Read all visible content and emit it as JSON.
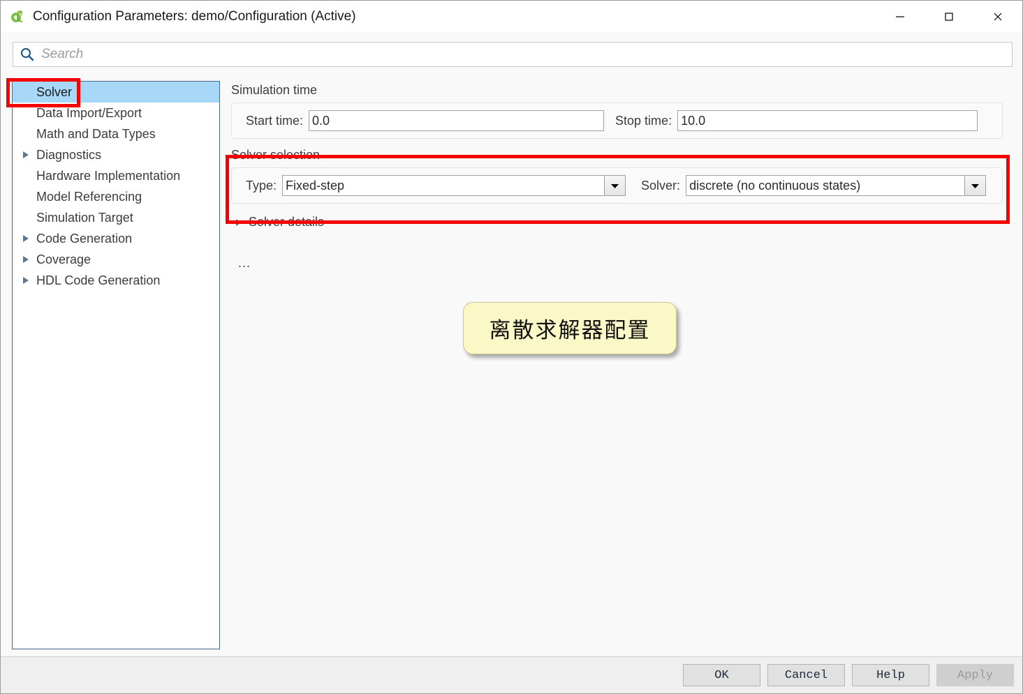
{
  "window": {
    "title": "Configuration Parameters: demo/Configuration (Active)",
    "app_icon": "simulink-gear-icon",
    "controls": {
      "minimize": "—",
      "maximize": "□",
      "close": "✕"
    }
  },
  "search": {
    "placeholder": "Search",
    "value": "",
    "icon": "search-icon"
  },
  "sidebar": {
    "items": [
      {
        "label": "Solver",
        "expandable": false,
        "selected": true
      },
      {
        "label": "Data Import/Export",
        "expandable": false,
        "selected": false
      },
      {
        "label": "Math and Data Types",
        "expandable": false,
        "selected": false
      },
      {
        "label": "Diagnostics",
        "expandable": true,
        "selected": false
      },
      {
        "label": "Hardware Implementation",
        "expandable": false,
        "selected": false
      },
      {
        "label": "Model Referencing",
        "expandable": false,
        "selected": false
      },
      {
        "label": "Simulation Target",
        "expandable": false,
        "selected": false
      },
      {
        "label": "Code Generation",
        "expandable": true,
        "selected": false
      },
      {
        "label": "Coverage",
        "expandable": true,
        "selected": false
      },
      {
        "label": "HDL Code Generation",
        "expandable": true,
        "selected": false
      }
    ]
  },
  "main": {
    "simulation_time": {
      "group_title": "Simulation time",
      "start_time_label": "Start time:",
      "start_time_value": "0.0",
      "stop_time_label": "Stop time:",
      "stop_time_value": "10.0"
    },
    "solver_selection": {
      "group_title": "Solver selection",
      "type_label": "Type:",
      "type_value": "Fixed-step",
      "solver_label": "Solver:",
      "solver_value": "discrete (no continuous states)",
      "dropdown_icon": "chevron-down-icon"
    },
    "solver_details": {
      "label": "Solver details",
      "expander_icon": "triangle-right-icon",
      "expanded": false
    },
    "overflow_text": "..."
  },
  "annotations": {
    "callout_text": "离散求解器配置",
    "highlight_color": "#f50000",
    "callout_background": "#fbf8c8"
  },
  "footer": {
    "buttons": [
      {
        "label": "OK",
        "disabled": false
      },
      {
        "label": "Cancel",
        "disabled": false
      },
      {
        "label": "Help",
        "disabled": false
      },
      {
        "label": "Apply",
        "disabled": true
      }
    ]
  }
}
